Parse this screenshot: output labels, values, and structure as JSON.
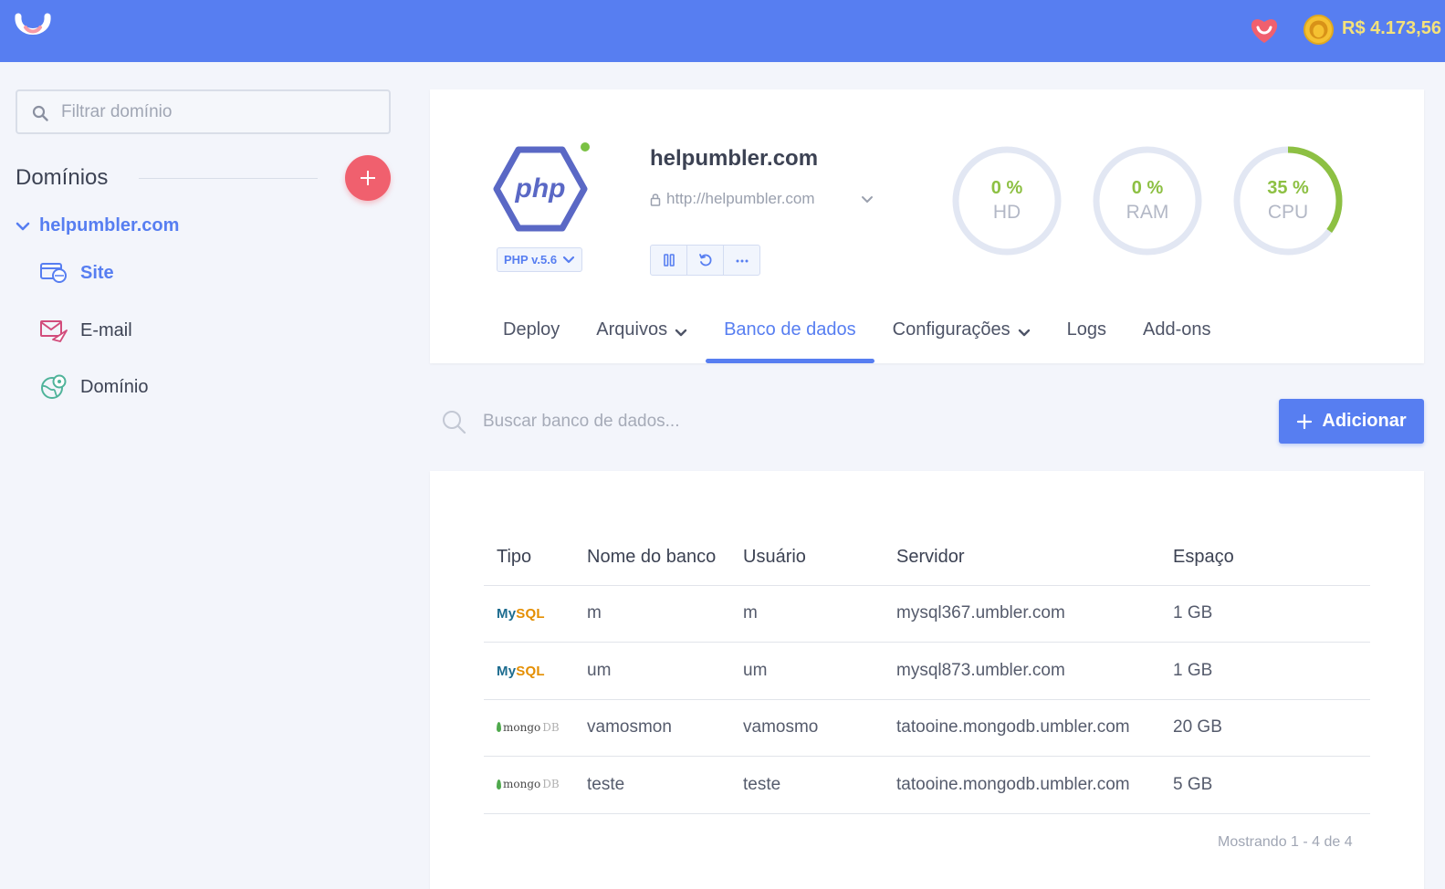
{
  "header": {
    "balance": "R$ 4.173,56",
    "colors": {
      "bar": "#577ef1",
      "balance": "#f5e27a"
    },
    "icons": [
      "umbler-logo-icon",
      "heart-icon",
      "coin-icon"
    ]
  },
  "sidebar": {
    "filter_placeholder": "Filtrar domínio",
    "section_title": "Domínios",
    "domain": "helpumbler.com",
    "items": [
      {
        "label": "Site",
        "icon": "site-icon",
        "active": true
      },
      {
        "label": "E-mail",
        "icon": "email-icon",
        "active": false
      },
      {
        "label": "Domínio",
        "icon": "globe-icon",
        "active": false
      }
    ]
  },
  "site": {
    "name": "helpumbler.com",
    "url": "http://helpumbler.com",
    "php_version": "PHP v.5.6",
    "status": "online",
    "logo_text": "php"
  },
  "gauges": [
    {
      "pct": "0 %",
      "label": "HD",
      "value": 0
    },
    {
      "pct": "0 %",
      "label": "RAM",
      "value": 0
    },
    {
      "pct": "35 %",
      "label": "CPU",
      "value": 0.35
    }
  ],
  "tabs": [
    {
      "label": "Deploy",
      "dropdown": false
    },
    {
      "label": "Arquivos",
      "dropdown": true
    },
    {
      "label": "Banco de dados",
      "dropdown": false,
      "active": true
    },
    {
      "label": "Configurações",
      "dropdown": true
    },
    {
      "label": "Logs",
      "dropdown": false
    },
    {
      "label": "Add-ons",
      "dropdown": false
    }
  ],
  "db": {
    "search_placeholder": "Buscar banco de dados...",
    "add_label": "Adicionar",
    "columns": [
      "Tipo",
      "Nome do banco",
      "Usuário",
      "Servidor",
      "Espaço"
    ],
    "rows": [
      {
        "type": "MySQL",
        "type_parts": [
          "My",
          "SQL"
        ],
        "name": "m",
        "user": "m",
        "server": "mysql367.umbler.com",
        "space": "1 GB"
      },
      {
        "type": "MySQL",
        "type_parts": [
          "My",
          "SQL"
        ],
        "name": "um",
        "user": "um",
        "server": "mysql873.umbler.com",
        "space": "1 GB"
      },
      {
        "type": "mongoDB",
        "type_parts": [
          "mongo",
          "DB"
        ],
        "name": "vamosmon",
        "user": "vamosmo",
        "server": "tatooine.mongodb.umbler.com",
        "space": "20 GB"
      },
      {
        "type": "mongoDB",
        "type_parts": [
          "mongo",
          "DB"
        ],
        "name": "teste",
        "user": "teste",
        "server": "tatooine.mongodb.umbler.com",
        "space": "5 GB"
      }
    ],
    "showing": "Mostrando 1 - 4 de 4"
  }
}
